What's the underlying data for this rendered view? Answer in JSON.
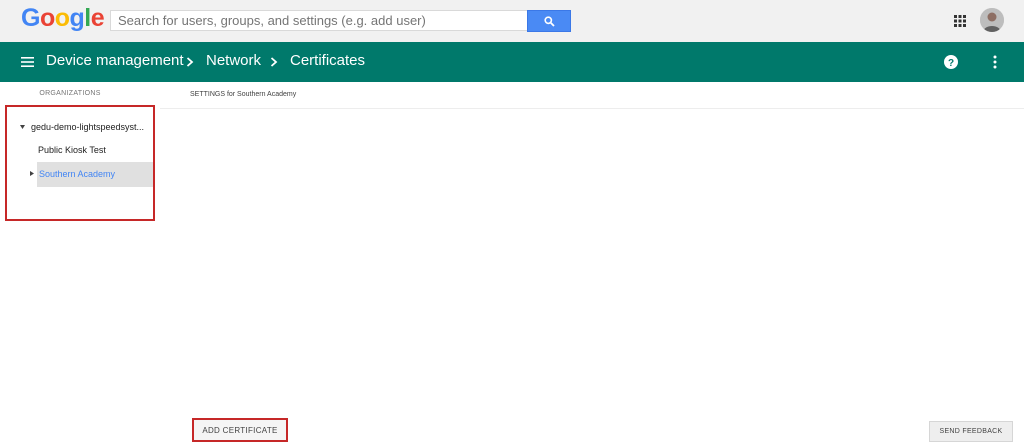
{
  "topbar": {
    "logo_letters": [
      "G",
      "o",
      "o",
      "g",
      "l",
      "e"
    ],
    "logo_colors": [
      "#4285f4",
      "#ea4335",
      "#fbbc05",
      "#4285f4",
      "#34a853",
      "#ea4335"
    ],
    "search_placeholder": "Search for users, groups, and settings (e.g. add user)",
    "search_icon": "search-icon",
    "apps_icon": "apps-grid-icon",
    "avatar": "user-avatar"
  },
  "header": {
    "color": "#00796b",
    "breadcrumbs": [
      "Device management",
      "Network",
      "Certificates"
    ],
    "help_icon": "help-icon",
    "more_icon": "more-vert-icon"
  },
  "sidebar": {
    "heading": "ORGANIZATIONS",
    "items": [
      {
        "label": "gedu-demo-lightspeedsyst...",
        "expanded": true
      },
      {
        "label": "Public Kiosk Test"
      },
      {
        "label": "Southern Academy",
        "selected": true,
        "collapsed": true
      }
    ]
  },
  "main": {
    "settings_heading": "SETTINGS for Southern Academy",
    "add_certificate_label": "ADD CERTIFICATE",
    "send_feedback_label": "SEND FEEDBACK"
  },
  "annotation_color": "#c62828"
}
